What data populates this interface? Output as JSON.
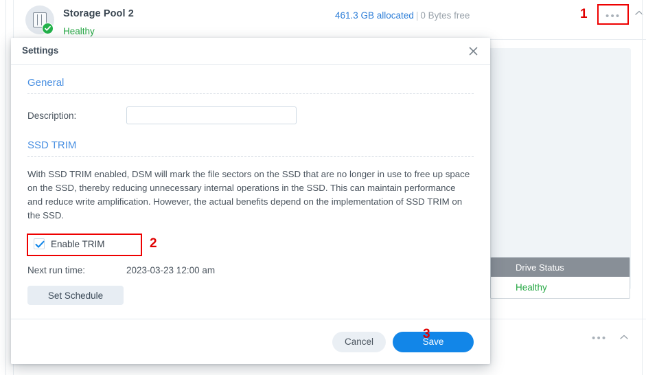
{
  "background": {
    "pool": {
      "icon": "storage-pool-icon",
      "status_badge_icon": "check-circle-icon",
      "title": "Storage Pool 2",
      "status": "Healthy",
      "allocated": "461.3 GB allocated",
      "separator": "|",
      "free": "0 Bytes free",
      "more_icon": "ellipsis-icon",
      "collapse_icon": "chevron-up-icon",
      "annotation": "1"
    },
    "drive_status": {
      "header": "Drive Status",
      "value": "Healthy"
    },
    "bottom_row": {
      "more_icon": "ellipsis-icon",
      "collapse_icon": "chevron-up-icon"
    }
  },
  "dialog": {
    "title": "Settings",
    "close_icon": "close-icon",
    "general": {
      "section_title": "General",
      "description_label": "Description:",
      "description_value": "",
      "description_placeholder": ""
    },
    "ssd_trim": {
      "section_title": "SSD TRIM",
      "description": "With SSD TRIM enabled, DSM will mark the file sectors on the SSD that are no longer in use to free up space on the SSD, thereby reducing unnecessary internal operations in the SSD. This can maintain performance and reduce write amplification. However, the actual benefits depend on the implementation of SSD TRIM on the SSD.",
      "enable_trim_label": "Enable TRIM",
      "enable_trim_checked": true,
      "enable_trim_annotation": "2",
      "next_run_label": "Next run time:",
      "next_run_value": "2023-03-23 12:00 am",
      "set_schedule_label": "Set Schedule"
    },
    "footer": {
      "cancel_label": "Cancel",
      "save_label": "Save",
      "save_annotation": "3"
    }
  },
  "colors": {
    "accent_blue": "#1286e8",
    "section_blue": "#4a90e2",
    "healthy_green": "#26a844",
    "annotation_red": "#e00000",
    "panel_bg": "#f0f4f7",
    "drive_status_header": "#888f97"
  }
}
